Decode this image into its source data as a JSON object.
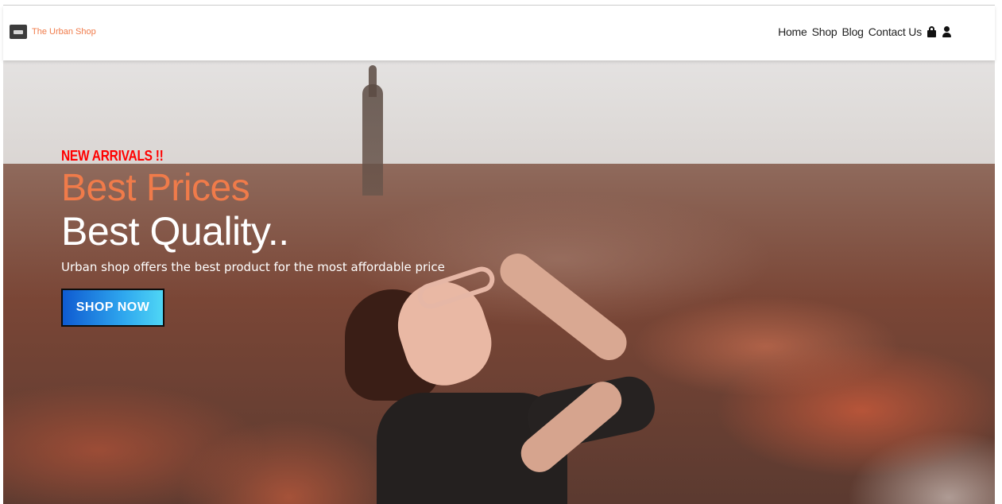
{
  "header": {
    "brand_name": "The Urban Shop",
    "nav": [
      {
        "label": "Home"
      },
      {
        "label": "Shop"
      },
      {
        "label": "Blog"
      },
      {
        "label": "Contact Us"
      }
    ],
    "icons": [
      "shopping-bag-icon",
      "user-icon"
    ]
  },
  "hero": {
    "tag": "NEW ARRIVALS !!",
    "line1": "Best Prices",
    "line2": "Best Quality..",
    "description": "Urban shop offers the best product for the most affordable price",
    "cta_label": "SHOP NOW"
  },
  "colors": {
    "accent": "#f07b4a",
    "tag": "#ff0000",
    "cta_start": "#0f5bd1",
    "cta_end": "#4fd6f5"
  }
}
